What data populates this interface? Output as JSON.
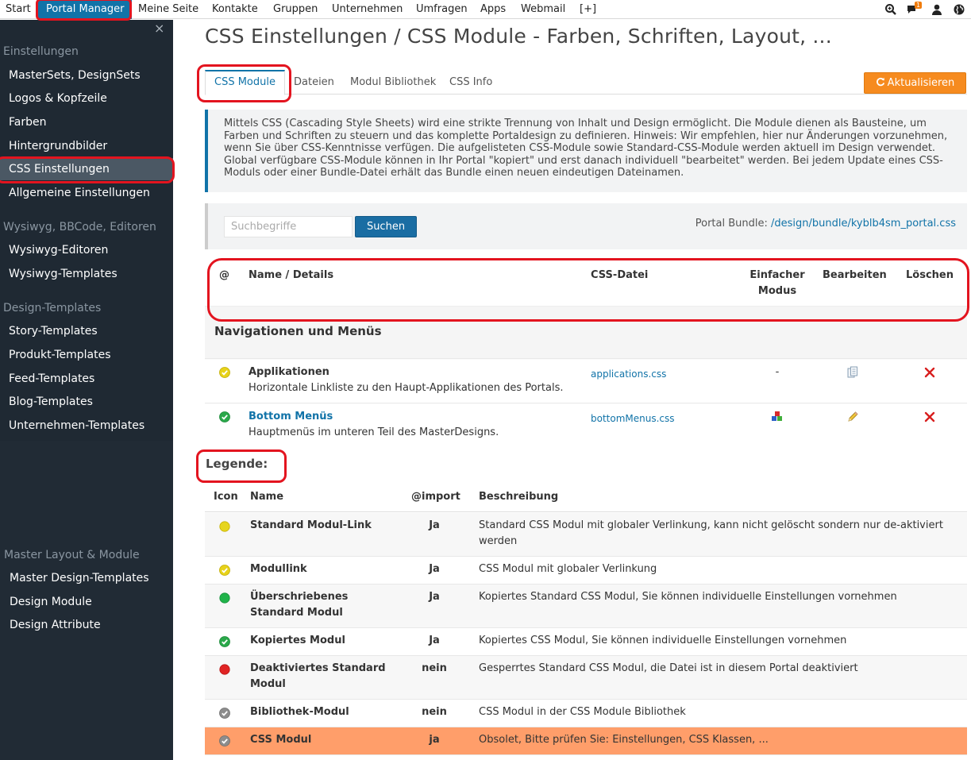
{
  "topnav": {
    "items": [
      "Start",
      "Portal Manager",
      "Meine Seite",
      "Kontakte",
      "Gruppen",
      "Unternehmen",
      "Umfragen",
      "Apps",
      "Webmail",
      "[+]"
    ],
    "badge_count": "1",
    "icons": [
      "search-zoom-icon",
      "chat-icon",
      "user-icon",
      "globe-icon"
    ]
  },
  "sidebar": {
    "close": "×",
    "sections": [
      {
        "title": "Einstellungen",
        "items": [
          "MasterSets, DesignSets",
          "Logos & Kopfzeile",
          "Farben",
          "Hintergrundbilder",
          "CSS Einstellungen",
          "Allgemeine Einstellungen"
        ]
      },
      {
        "title": "Wysiwyg, BBCode, Editoren",
        "items": [
          "Wysiwyg-Editoren",
          "Wysiwyg-Templates"
        ]
      },
      {
        "title": "Design-Templates",
        "items": [
          "Story-Templates",
          "Produkt-Templates",
          "Feed-Templates",
          "Blog-Templates",
          "Unternehmen-Templates"
        ]
      },
      {
        "title": "Master Layout & Module",
        "items": [
          "Master Design-Templates",
          "Design Module",
          "Design Attribute"
        ]
      }
    ]
  },
  "main": {
    "title": "CSS Einstellungen / CSS Module - Farben, Schriften, Layout, ...",
    "tabs": [
      "CSS Module",
      "Dateien",
      "Modul Bibliothek",
      "CSS Info"
    ],
    "refresh_label": "Aktualisieren",
    "info_text": "Mittels CSS (Cascading Style Sheets) wird eine strikte Trennung von Inhalt und Design ermöglicht. Die Module dienen als Bausteine, um Farben und Schriften zu steuern und das komplette Portaldesign zu definieren. Hinweis: Wir empfehlen, hier nur Änderungen vorzunehmen, wenn Sie über CSS-Kenntnisse verfügen. Die aufgelisteten CSS-Module sowie Standard-CSS-Module werden aktuell im Design verwendet. Global verfügbare CSS-Module können in Ihr Portal \"kopiert\" und erst danach individuell \"bearbeitet\" werden. Bei jedem Update eines CSS-Moduls oder einer Bundle-Datei erhält das Bundle einen neuen eindeutigen Dateinamen.",
    "search": {
      "placeholder": "Suchbegriffe",
      "button": "Suchen"
    },
    "bundle": {
      "label": "Portal Bundle:",
      "link": "/design/bundle/kyblb4sm_portal.css"
    }
  },
  "module_table": {
    "headers": {
      "at": "@",
      "name": "Name / Details",
      "file": "CSS-Datei",
      "simple_1": "Einfacher",
      "simple_2": "Modus",
      "edit": "Bearbeiten",
      "delete": "Löschen"
    },
    "group": "Navigationen und Menüs",
    "rows": [
      {
        "status": "modullink",
        "name": "Applikationen",
        "desc": "Horizontale Linkliste zu den Haupt-Applikationen des Portals.",
        "file": "applications.css",
        "simple": "-",
        "edit_icon": "copy-icon",
        "delete_icon": "delete-x-icon"
      },
      {
        "status": "copied",
        "name": "Bottom Menüs",
        "desc": "Hauptmenüs im unteren Teil des MasterDesigns.",
        "file": "bottomMenus.css",
        "simple": "",
        "simple_icon": "blocks-icon",
        "edit_icon": "pencil-icon",
        "delete_icon": "delete-x-icon"
      }
    ]
  },
  "legend": {
    "title": "Legende:",
    "headers": {
      "icon": "Icon",
      "name": "Name",
      "import": "@import",
      "desc": "Beschreibung"
    },
    "rows": [
      {
        "icon": "yellow-dot-icon",
        "name": "Standard Modul-Link",
        "import": "Ja",
        "desc": "Standard CSS Modul mit globaler Verlinkung, kann nicht gelöscht sondern nur de-aktiviert werden"
      },
      {
        "icon": "yellow-check-icon",
        "name": "Modullink",
        "import": "Ja",
        "desc": "CSS Modul mit globaler Verlinkung"
      },
      {
        "icon": "green-dot-icon",
        "name": "Überschriebenes Standard Modul",
        "import": "Ja",
        "desc": "Kopiertes Standard CSS Modul, Sie können individuelle Einstellungen vornehmen"
      },
      {
        "icon": "green-check-icon",
        "name": "Kopiertes Modul",
        "import": "Ja",
        "desc": "Kopiertes CSS Modul, Sie können individuelle Einstellungen vornehmen"
      },
      {
        "icon": "red-dot-icon",
        "name": "Deaktiviertes Standard Modul",
        "import": "nein",
        "desc": "Gesperrtes Standard CSS Modul, die Datei ist in diesem Portal deaktiviert"
      },
      {
        "icon": "grey-check-icon",
        "name": "Bibliothek-Modul",
        "import": "nein",
        "desc": "CSS Modul in der CSS Module Bibliothek"
      },
      {
        "icon": "grey-check-icon",
        "name": "CSS Modul",
        "import": "ja",
        "desc": "Obsolet, Bitte prüfen Sie: Einstellungen, CSS Klassen, ..."
      }
    ]
  },
  "colors": {
    "accent": "#1173a8",
    "sidebar": "#212b35",
    "orange": "#f68b1f",
    "annotation": "#e3141f",
    "warn_row": "#ff9e6a"
  }
}
